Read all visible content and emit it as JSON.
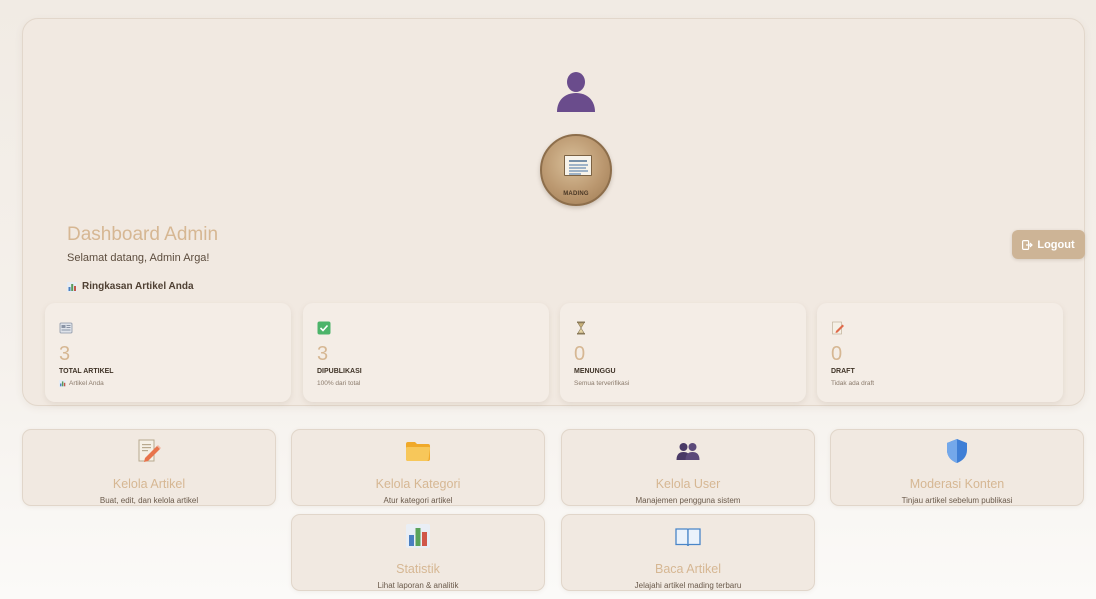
{
  "header": {
    "title": "Dashboard Admin",
    "welcome": "Selamat datang, Admin Arga!",
    "logout_label": "Logout",
    "logo_text": "MADING"
  },
  "summary": {
    "heading": "Ringkasan Artikel Anda",
    "stats": [
      {
        "icon": "newspaper-icon",
        "value": "3",
        "label": "TOTAL ARTIKEL",
        "sub": "Artikel Anda"
      },
      {
        "icon": "check-box-icon",
        "value": "3",
        "label": "DIPUBLIKASI",
        "sub": "100% dari total"
      },
      {
        "icon": "hourglass-icon",
        "value": "0",
        "label": "MENUNGGU",
        "sub": "Semua terverifikasi"
      },
      {
        "icon": "memo-icon",
        "value": "0",
        "label": "DRAFT",
        "sub": "Tidak ada draft"
      }
    ]
  },
  "actions": [
    {
      "icon": "memo-icon",
      "title": "Kelola Artikel",
      "desc": "Buat, edit, dan kelola artikel"
    },
    {
      "icon": "folder-icon",
      "title": "Kelola Kategori",
      "desc": "Atur kategori artikel"
    },
    {
      "icon": "users-icon",
      "title": "Kelola User",
      "desc": "Manajemen pengguna sistem"
    },
    {
      "icon": "shield-icon",
      "title": "Moderasi Konten",
      "desc": "Tinjau artikel sebelum publikasi"
    },
    {
      "icon": "bar-chart-icon",
      "title": "Statistik",
      "desc": "Lihat laporan & analitik"
    },
    {
      "icon": "book-icon",
      "title": "Baca Artikel",
      "desc": "Jelajahi artikel mading terbaru"
    }
  ],
  "colors": {
    "accent": "#d6b793",
    "logout_bg": "#cdb496",
    "card_bg": "#f1e9e1",
    "user_icon": "#6a4c8c"
  }
}
